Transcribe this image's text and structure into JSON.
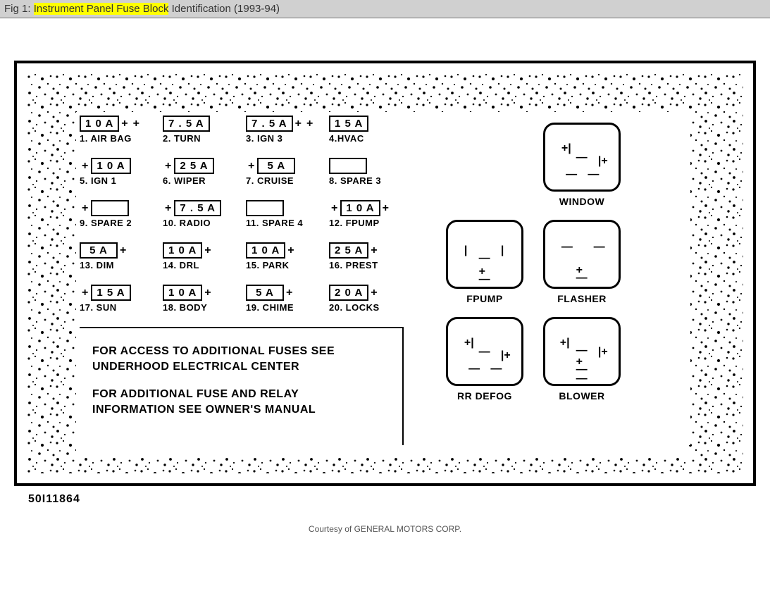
{
  "header": {
    "fig_prefix": "Fig 1: ",
    "highlight": "Instrument Panel Fuse Block",
    "suffix": " Identification (1993-94)"
  },
  "fuses": [
    [
      {
        "amp": "1 0 A",
        "plus_left": false,
        "plus_right_inner": true,
        "plus_right_outer": true,
        "label": "1. AIR BAG"
      },
      {
        "amp": "7 . 5 A",
        "plus_left": false,
        "plus_right_inner": false,
        "plus_right_outer": false,
        "label": "2. TURN"
      },
      {
        "amp": "7 . 5 A",
        "plus_left": false,
        "plus_right_inner": true,
        "plus_right_outer": true,
        "label": "3. IGN 3"
      },
      {
        "amp": "1 5 A",
        "plus_left": false,
        "plus_right_inner": false,
        "plus_right_outer": false,
        "label": "4.HVAC"
      }
    ],
    [
      {
        "amp": "1 0 A",
        "plus_left": true,
        "plus_right_inner": false,
        "plus_right_outer": false,
        "label": "5. IGN 1"
      },
      {
        "amp": "2 5 A",
        "plus_left": true,
        "plus_right_inner": false,
        "plus_right_outer": false,
        "label": "6. WIPER"
      },
      {
        "amp": "5 A",
        "plus_left": true,
        "plus_right_inner": false,
        "plus_right_outer": false,
        "label": "7. CRUISE"
      },
      {
        "amp": "",
        "plus_left": false,
        "plus_right_inner": false,
        "plus_right_outer": false,
        "label": "8. SPARE 3"
      }
    ],
    [
      {
        "amp": "",
        "plus_left": true,
        "plus_right_inner": false,
        "plus_right_outer": false,
        "label": "9. SPARE 2"
      },
      {
        "amp": "7 . 5 A",
        "plus_left": true,
        "plus_right_inner": false,
        "plus_right_outer": false,
        "label": "10. RADIO"
      },
      {
        "amp": "",
        "plus_left": false,
        "plus_right_inner": false,
        "plus_right_outer": false,
        "label": "11. SPARE 4"
      },
      {
        "amp": "1 0 A",
        "plus_left": true,
        "plus_right_inner": true,
        "plus_right_outer": false,
        "label": "12. FPUMP"
      }
    ],
    [
      {
        "amp": "5 A",
        "plus_left": false,
        "plus_right_inner": true,
        "plus_right_outer": false,
        "label": "13. DIM"
      },
      {
        "amp": "1 0 A",
        "plus_left": false,
        "plus_right_inner": true,
        "plus_right_outer": false,
        "label": "14. DRL"
      },
      {
        "amp": "1 0 A",
        "plus_left": false,
        "plus_right_inner": true,
        "plus_right_outer": false,
        "label": "15. PARK"
      },
      {
        "amp": "2 5 A",
        "plus_left": false,
        "plus_right_inner": true,
        "plus_right_outer": false,
        "label": "16. PREST"
      }
    ],
    [
      {
        "amp": "1 5 A",
        "plus_left": true,
        "plus_right_inner": false,
        "plus_right_outer": false,
        "label": "17. SUN"
      },
      {
        "amp": "1 0 A",
        "plus_left": false,
        "plus_right_inner": true,
        "plus_right_outer": false,
        "label": "18. BODY"
      },
      {
        "amp": "5 A",
        "plus_left": false,
        "plus_right_inner": true,
        "plus_right_outer": false,
        "label": "19. CHIME"
      },
      {
        "amp": "2 0 A",
        "plus_left": false,
        "plus_right_inner": true,
        "plus_right_outer": false,
        "label": "20. LOCKS"
      }
    ]
  ],
  "notes": {
    "line1": "FOR ACCESS TO ADDITIONAL FUSES SEE UNDERHOOD ELECTRICAL CENTER",
    "line2": "FOR ADDITIONAL FUSE AND RELAY INFORMATION SEE OWNER'S MANUAL"
  },
  "relays": [
    {
      "label": "WINDOW",
      "type": "A"
    },
    {
      "label": "FPUMP",
      "type": "B"
    },
    {
      "label": "FLASHER",
      "type": "C"
    },
    {
      "label": "RR DEFOG",
      "type": "A"
    },
    {
      "label": "BLOWER",
      "type": "D"
    }
  ],
  "id_code": "50I11864",
  "courtesy": "Courtesy of GENERAL MOTORS CORP."
}
